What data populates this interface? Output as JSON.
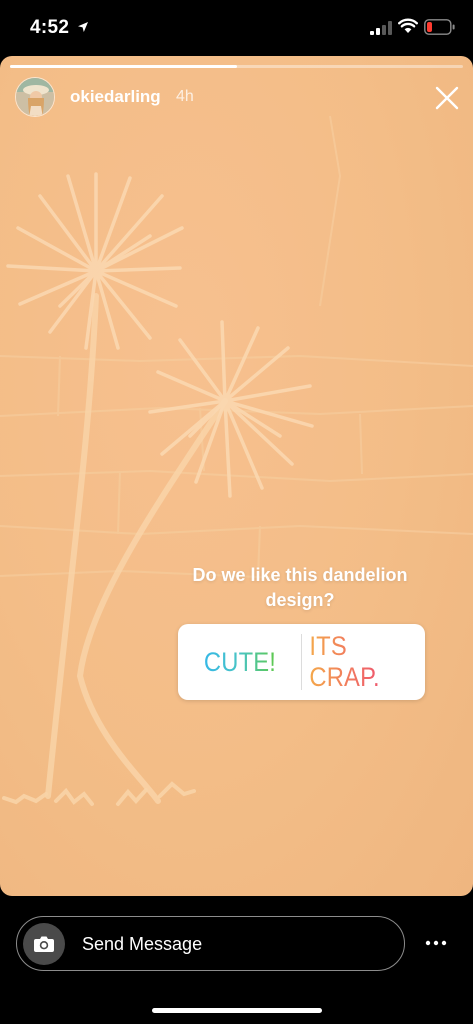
{
  "status_bar": {
    "time": "4:52"
  },
  "story": {
    "username": "okiedarling",
    "posted": "4h",
    "progress": 0.5
  },
  "poll": {
    "question": "Do we like this dandelion design?",
    "options": [
      "CUTE!",
      "ITS CRAP."
    ]
  },
  "reply": {
    "placeholder": "Send Message"
  },
  "colors": {
    "story_background": "#f3bd87",
    "poll_left_gradient": [
      "#36b8e6",
      "#5fc94a"
    ],
    "poll_right_gradient": [
      "#f4a84a",
      "#e6468a"
    ]
  },
  "icons": [
    "location-arrow-icon",
    "signal-icon",
    "wifi-icon",
    "battery-icon",
    "close-icon",
    "camera-icon",
    "more-icon"
  ]
}
